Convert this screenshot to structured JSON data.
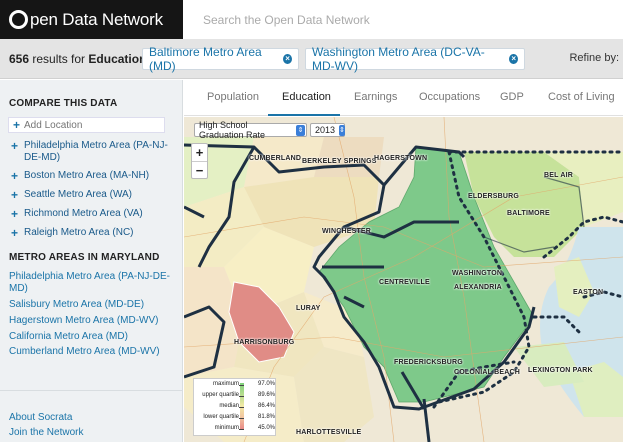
{
  "header": {
    "logo_o": "O",
    "logo_text": "pen Data Network",
    "search_placeholder": "Search the Open Data Network"
  },
  "filterbar": {
    "count": "656",
    "results_text": "results for",
    "topic": "Education",
    "chips": [
      "Baltimore Metro Area (MD)",
      "Washington Metro Area (DC-VA-MD-WV)"
    ],
    "refine_label": "Refine by:"
  },
  "sidebar": {
    "compare_title": "COMPARE THIS DATA",
    "add_location_placeholder": "Add Location",
    "compare_items": [
      "Philadelphia Metro Area (PA-NJ-DE-MD)",
      "Boston Metro Area (MA-NH)",
      "Seattle Metro Area (WA)",
      "Richmond Metro Area (VA)",
      "Raleigh Metro Area (NC)"
    ],
    "metro_title": "METRO AREAS IN MARYLAND",
    "metro_links": [
      "Philadelphia Metro Area (PA-NJ-DE-MD)",
      "Salisbury Metro Area (MD-DE)",
      "Hagerstown Metro Area (MD-WV)",
      "California Metro Area (MD)",
      "Cumberland Metro Area (MD-WV)"
    ],
    "footer_links": [
      "About Socrata",
      "Join the Network"
    ]
  },
  "tabs": [
    "Population",
    "Education",
    "Earnings",
    "Occupations",
    "GDP",
    "Cost of Living"
  ],
  "active_tab": "Education",
  "map": {
    "metric_select": "High School Graduation Rate",
    "year_select": "2013",
    "zoom_in": "+",
    "zoom_out": "−",
    "labels": [
      "CUMBERLAND",
      "BERKELEY SPRINGS",
      "HAGERSTOWN",
      "BEL AIR",
      "ELDERSBURG",
      "BALTIMORE",
      "WINCHESTER",
      "WASHINGTON",
      "CENTREVILLE",
      "ALEXANDRIA",
      "EASTON",
      "LURAY",
      "HARRISONBURG",
      "FREDERICKSBURG",
      "COLONIAL BEACH",
      "LEXINGTON PARK",
      "HARLOTTESVILLE"
    ],
    "legend": [
      {
        "label": "maximum",
        "value": "97.0%"
      },
      {
        "label": "upper quartile",
        "value": "89.6%"
      },
      {
        "label": "median",
        "value": "86.4%"
      },
      {
        "label": "lower quartile",
        "value": "81.8%"
      },
      {
        "label": "minimum",
        "value": "45.0%"
      }
    ]
  },
  "colors": {
    "accent": "#1a74a8",
    "header_bg": "#151515",
    "washington_fill": "#7ec98a",
    "baltimore_fill": "#c6e29a",
    "harrisonburg_fill": "#e08c86"
  }
}
